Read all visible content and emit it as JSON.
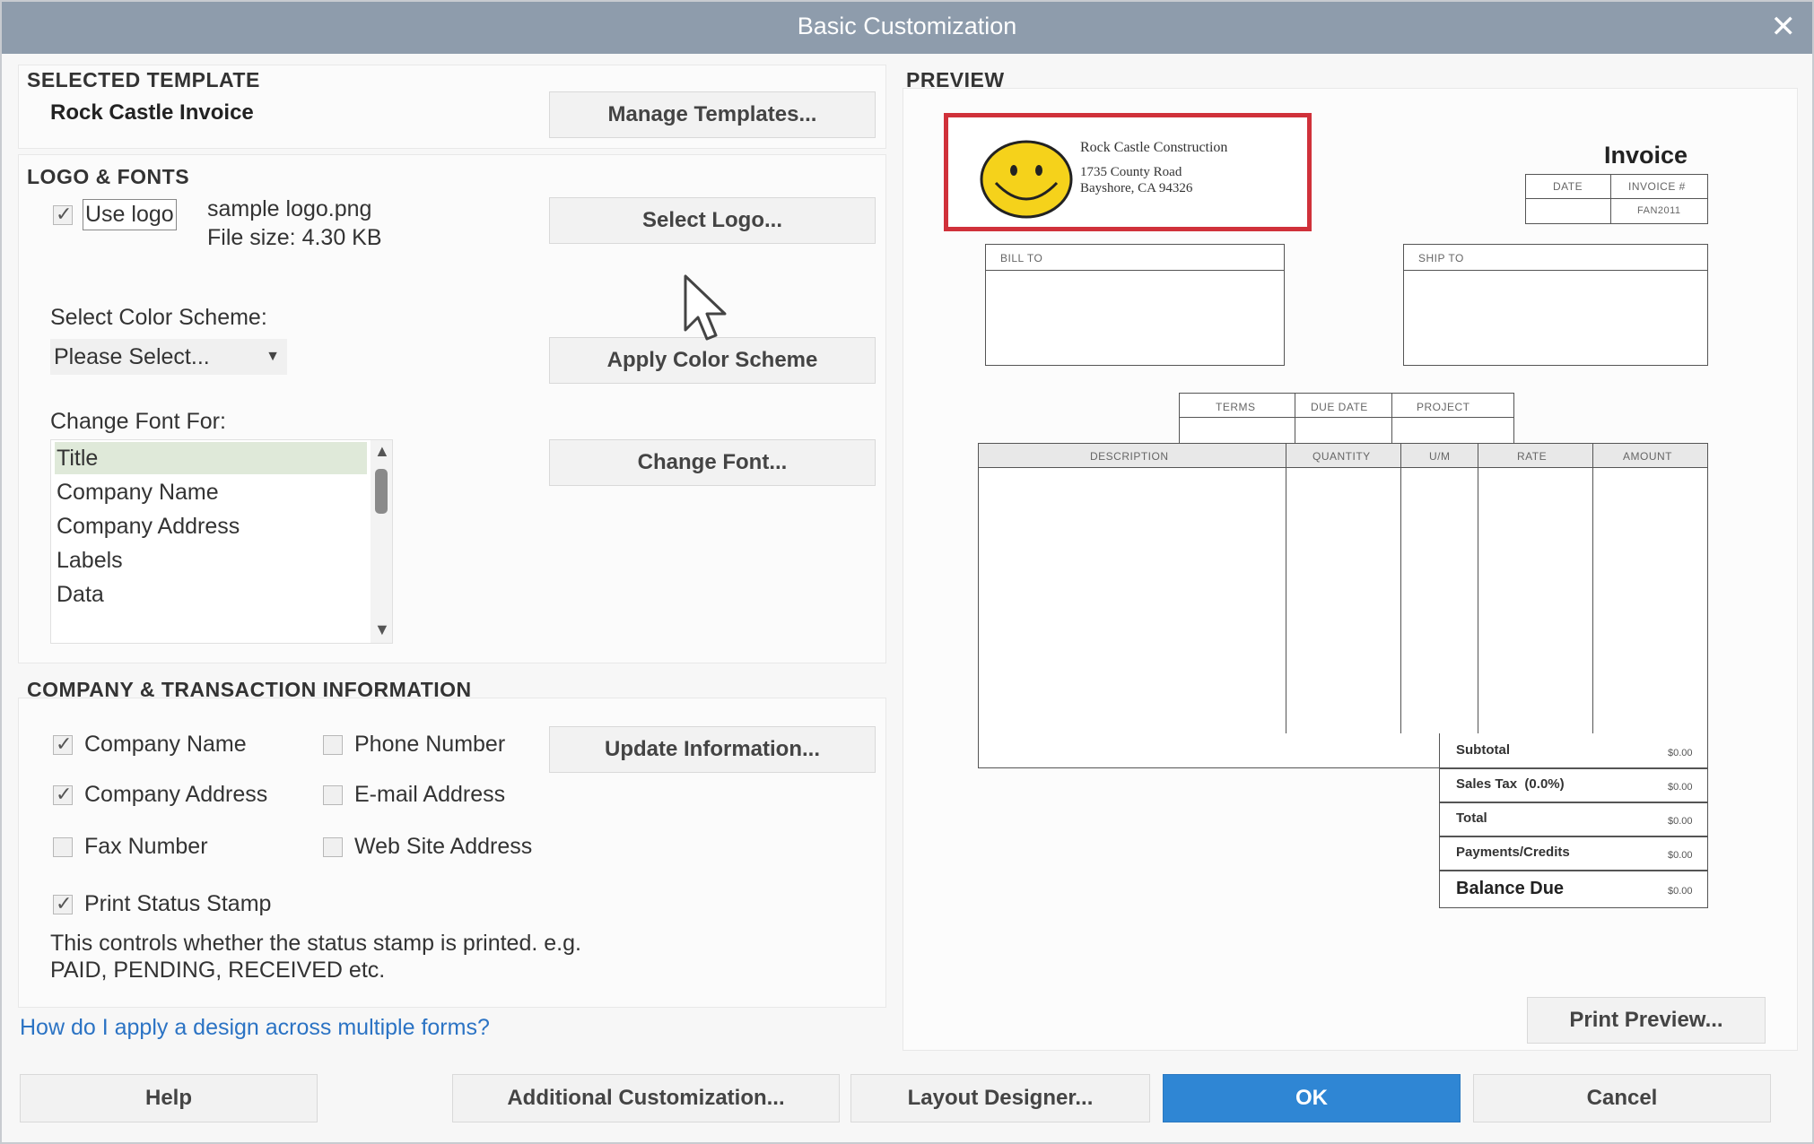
{
  "window": {
    "title": "Basic Customization"
  },
  "selected_template": {
    "heading": "SELECTED TEMPLATE",
    "name": "Rock Castle Invoice",
    "manage_label": "Manage Templates..."
  },
  "logo_fonts": {
    "heading": "LOGO & FONTS",
    "use_logo_label": "Use logo",
    "use_logo_checked": true,
    "logo_file": "sample logo.png",
    "file_size": "File size: 4.30 KB",
    "select_logo_label": "Select Logo...",
    "color_scheme_label": "Select Color Scheme:",
    "color_scheme_value": "Please Select...",
    "apply_color_label": "Apply Color Scheme",
    "change_font_for_label": "Change Font For:",
    "font_items": [
      "Title",
      "Company Name",
      "Company Address",
      "Labels",
      "Data"
    ],
    "selected_font_item": "Title",
    "change_font_label": "Change Font..."
  },
  "company_info": {
    "heading": "COMPANY & TRANSACTION INFORMATION",
    "company_name": "Company Name",
    "company_address": "Company Address",
    "fax_number": "Fax Number",
    "phone_number": "Phone Number",
    "email_address": "E-mail Address",
    "web_site": "Web Site Address",
    "update_label": "Update Information...",
    "print_status": "Print Status Stamp",
    "status_desc_1": "This controls whether the status stamp is printed. e.g.",
    "status_desc_2": "PAID, PENDING, RECEIVED etc."
  },
  "help_link": "How do I apply a design across multiple forms?",
  "preview": {
    "heading": "PREVIEW",
    "company_name": "Rock Castle Construction",
    "address_1": "1735 County Road",
    "address_2": "Bayshore, CA 94326",
    "invoice_title": "Invoice",
    "date_label": "DATE",
    "invoice_no_label": "INVOICE #",
    "invoice_no_value": "FAN2011",
    "bill_to": "BILL TO",
    "ship_to": "SHIP TO",
    "terms": "TERMS",
    "due_date": "DUE DATE",
    "project": "PROJECT",
    "columns": [
      "DESCRIPTION",
      "QUANTITY",
      "U/M",
      "RATE",
      "AMOUNT"
    ],
    "totals": [
      {
        "label": "Subtotal",
        "value": "$0.00"
      },
      {
        "label": "Sales Tax  (0.0%)",
        "value": "$0.00"
      },
      {
        "label": "Total",
        "value": "$0.00"
      },
      {
        "label": "Payments/Credits",
        "value": "$0.00"
      },
      {
        "label": "Balance Due",
        "value": "$0.00"
      }
    ],
    "print_preview_label": "Print Preview..."
  },
  "footer": {
    "help": "Help",
    "additional": "Additional Customization...",
    "layout": "Layout Designer...",
    "ok": "OK",
    "cancel": "Cancel"
  },
  "colors": {
    "titlebar": "#8e9cac",
    "ok_button": "#2f86d4",
    "logo_highlight": "#d0313a",
    "smiley": "#f5d21b",
    "link": "#2b73c4"
  }
}
